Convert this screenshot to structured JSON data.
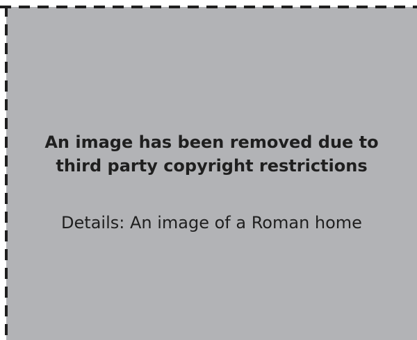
{
  "notice": {
    "title": "An image has been removed due to\nthird party copyright restrictions",
    "details": "Details: An image of a Roman home"
  },
  "colors": {
    "panel_background": "#b2b3b6",
    "dash_color": "#1f1f1f",
    "text_color": "#1f1f1f"
  }
}
